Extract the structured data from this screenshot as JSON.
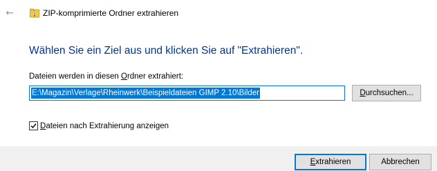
{
  "header": {
    "title": "ZIP-komprimierte Ordner extrahieren",
    "back_icon": "back-arrow-icon",
    "folder_icon": "zip-folder-icon"
  },
  "main": {
    "instruction": "Wählen Sie ein Ziel aus und klicken Sie auf \"Extrahieren\".",
    "path_label": {
      "pre": "Dateien werden in diesen ",
      "accel": "O",
      "post": "rdner extrahiert:"
    },
    "path_value": "E:\\Magazin\\Verlage\\Rheinwerk\\Beispieldateien GIMP 2.10\\Bilder",
    "browse_button": {
      "accel": "D",
      "rest": "urchsuchen..."
    },
    "show_files_checkbox": {
      "checked": true,
      "accel": "D",
      "rest": "ateien nach Extrahierung anzeigen"
    }
  },
  "footer": {
    "extract_button": {
      "accel": "E",
      "rest": "xtrahieren"
    },
    "cancel_label": "Abbrechen"
  },
  "colors": {
    "instruction": "#003399",
    "accent": "#0078d7",
    "footer_bg": "#f0f0f0",
    "button_bg": "#e1e1e1"
  }
}
